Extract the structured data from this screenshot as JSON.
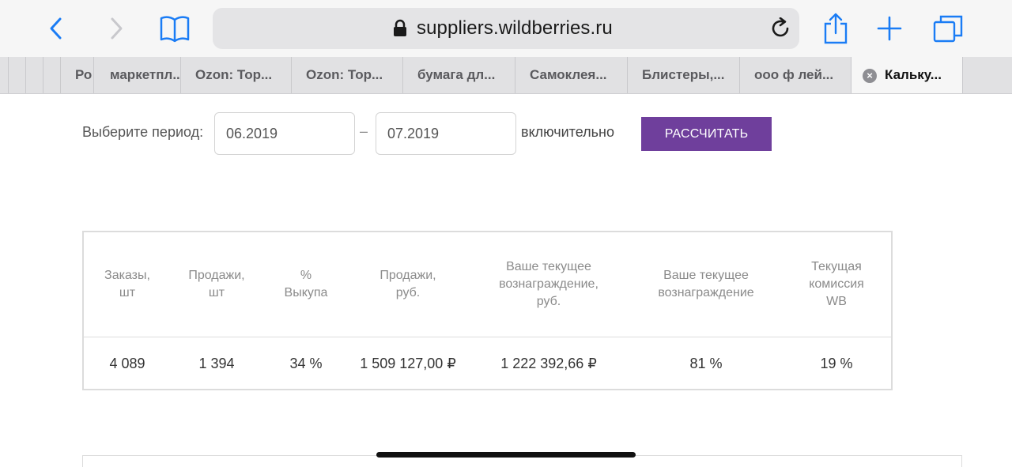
{
  "browser": {
    "url": "suppliers.wildberries.ru",
    "icons": [
      "back-icon",
      "forward-icon",
      "bookmarks-icon",
      "lock-icon",
      "reload-icon",
      "share-icon",
      "new-tab-icon",
      "tabs-overview-icon"
    ],
    "accent": "#1a7cf5"
  },
  "tabs": [
    {
      "label": "Ро"
    },
    {
      "label": "маркетпл..."
    },
    {
      "label": "Ozon: Тор..."
    },
    {
      "label": "Ozon: Тор..."
    },
    {
      "label": "бумага дл..."
    },
    {
      "label": "Самоклея..."
    },
    {
      "label": "Блистеры,..."
    },
    {
      "label": "ооо ф лей..."
    },
    {
      "label": "Кальку...",
      "active": true
    }
  ],
  "period": {
    "label": "Выберите период:",
    "from": "06.2019",
    "separator": "–",
    "to": "07.2019",
    "inclusive": "включительно",
    "calculate_button": "РАССЧИТАТЬ",
    "button_color": "#6f3f9c"
  },
  "stats": {
    "headers": [
      "Заказы,\nшт",
      "Продажи,\nшт",
      "%\nВыкупа",
      "Продажи,\nруб.",
      "Ваше текущее\nвознаграждение,\nруб.",
      "Ваше текущее\nвознаграждение",
      "Текущая\nкомиссия\nWB"
    ],
    "values": [
      "4 089",
      "1 394",
      "34 %",
      "1 509 127,00 ₽",
      "1 222 392,66 ₽",
      "81 %",
      "19 %"
    ]
  }
}
